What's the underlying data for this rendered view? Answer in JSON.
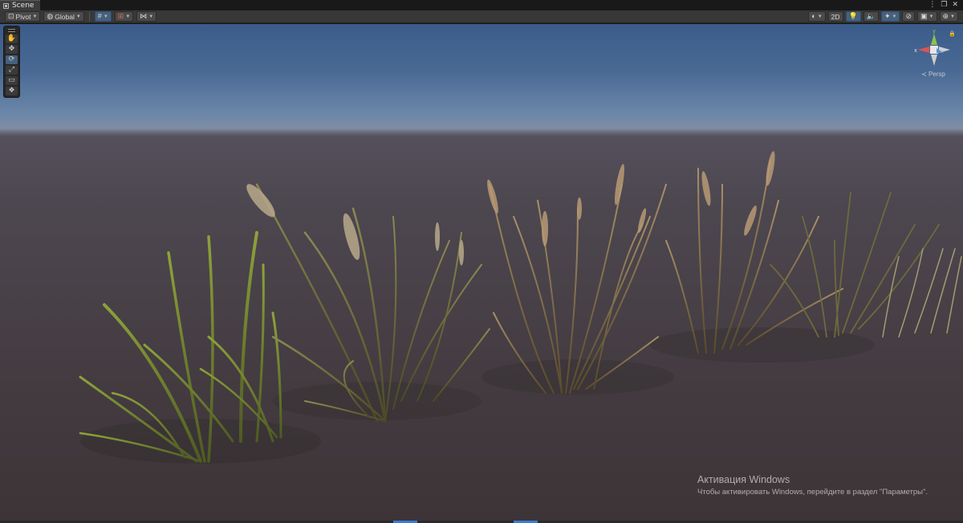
{
  "tab": {
    "title": "Scene",
    "icon": "scene-icon"
  },
  "window_controls": {
    "menu": "⋮",
    "maximize": "❐",
    "close": "✕"
  },
  "toolbar": {
    "pivot_label": "Pivot",
    "global_label": "Global",
    "mode_2d_label": "2D"
  },
  "tools": [
    {
      "name": "hand-tool",
      "icon": "✋"
    },
    {
      "name": "move-tool",
      "icon": "✥"
    },
    {
      "name": "rotate-tool",
      "icon": "⟳"
    },
    {
      "name": "scale-tool",
      "icon": "⤢"
    },
    {
      "name": "rect-tool",
      "icon": "▭"
    },
    {
      "name": "transform-tool",
      "icon": "❖"
    }
  ],
  "gizmo": {
    "x_label": "x",
    "y_label": "y",
    "projection_label": "Persp"
  },
  "watermark": {
    "title": "Активация Windows",
    "subtitle": "Чтобы активировать Windows, перейдите в раздел \"Параметры\"."
  },
  "colors": {
    "accent": "#46607e",
    "sky_top": "#3b5b8a",
    "ground": "#433b40"
  }
}
